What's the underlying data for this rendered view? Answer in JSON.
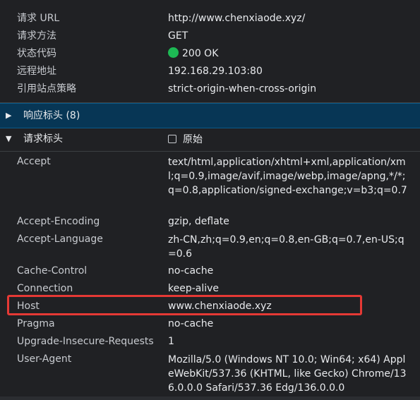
{
  "general": {
    "rows": [
      {
        "key": "请求 URL",
        "value": "http://www.chenxiaode.xyz/"
      },
      {
        "key": "请求方法",
        "value": "GET"
      },
      {
        "key": "状态代码",
        "value": "200 OK",
        "status_color": "#1db954"
      },
      {
        "key": "远程地址",
        "value": "192.168.29.103:80"
      },
      {
        "key": "引用站点策略",
        "value": "strict-origin-when-cross-origin"
      }
    ]
  },
  "response_headers": {
    "title": "响应标头 (8)",
    "expanded": false
  },
  "request_headers": {
    "title": "请求标头",
    "expanded": true,
    "raw_checkbox_label": "原始",
    "raw_checked": false,
    "rows": [
      {
        "key": "Accept",
        "value": "text/html,application/xhtml+xml,application/xml;q=0.9,image/avif,image/webp,image/apng,*/*;q=0.8,application/signed-exchange;v=b3;q=0.7"
      },
      {
        "key": "Accept-Encoding",
        "value": "gzip, deflate"
      },
      {
        "key": "Accept-Language",
        "value": "zh-CN,zh;q=0.9,en;q=0.8,en-GB;q=0.7,en-US;q=0.6"
      },
      {
        "key": "Cache-Control",
        "value": "no-cache"
      },
      {
        "key": "Connection",
        "value": "keep-alive"
      },
      {
        "key": "Host",
        "value": "www.chenxiaode.xyz",
        "highlighted": true
      },
      {
        "key": "Pragma",
        "value": "no-cache"
      },
      {
        "key": "Upgrade-Insecure-Requests",
        "value": "1"
      },
      {
        "key": "User-Agent",
        "value": "Mozilla/5.0 (Windows NT 10.0; Win64; x64) AppleWebKit/537.36 (KHTML, like Gecko) Chrome/136.0.0.0 Safari/537.36 Edg/136.0.0.0"
      }
    ]
  },
  "colors": {
    "background": "#202124",
    "section_header_bg": "#073655",
    "highlight_border": "#e53935",
    "status_ok": "#1db954"
  }
}
